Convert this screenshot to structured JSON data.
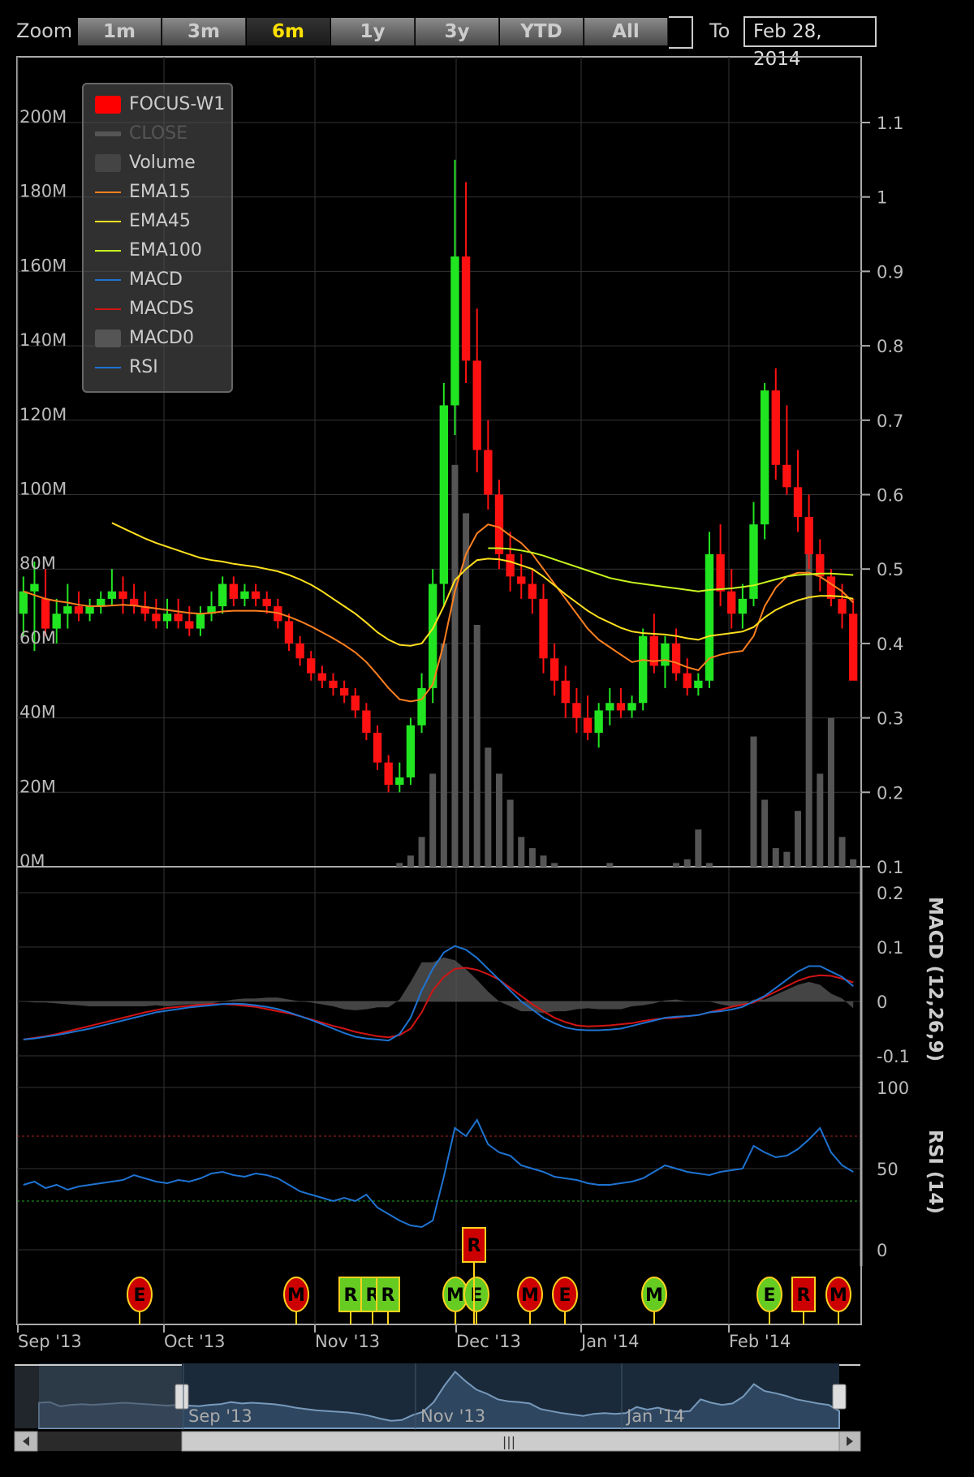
{
  "toolbar": {
    "zoom_label": "Zoom",
    "buttons": [
      "1m",
      "3m",
      "6m",
      "1y",
      "3y",
      "YTD",
      "All"
    ],
    "active": "6m",
    "to_label": "To",
    "to_date": "Feb 28, 2014"
  },
  "chart_data": [
    {
      "type": "candlestick",
      "series": [
        {
          "name": "FOCUS-W1",
          "color": "#ff0000"
        },
        {
          "name": "CLOSE",
          "color": "#444444",
          "hidden": true
        },
        {
          "name": "Volume",
          "color": "#444444"
        },
        {
          "name": "EMA15",
          "color": "#ff7f1e"
        },
        {
          "name": "EMA45",
          "color": "#ffe01e"
        },
        {
          "name": "EMA100",
          "color": "#c8f51e"
        },
        {
          "name": "MACD",
          "color": "#1e73d2"
        },
        {
          "name": "MACDS",
          "color": "#d21414"
        },
        {
          "name": "MACD0",
          "color": "#555555"
        },
        {
          "name": "RSI",
          "color": "#1e73d2"
        }
      ],
      "x_ticks": [
        "Sep '13",
        "Oct '13",
        "Nov '13",
        "Dec '13",
        "Jan '14",
        "Feb '14"
      ],
      "price_ticks": [
        "1.1",
        "1",
        "0.9",
        "0.8",
        "0.7",
        "0.6",
        "0.5",
        "0.4",
        "0.3",
        "0.2",
        "0.1"
      ],
      "volume_ticks": [
        "200M",
        "180M",
        "160M",
        "140M",
        "120M",
        "100M",
        "80M",
        "60M",
        "40M",
        "20M",
        "0M"
      ],
      "ylim_price": [
        0.1,
        1.1
      ],
      "ylim_volume": [
        0,
        200
      ],
      "grid": true,
      "ohlc": [
        [
          0.44,
          0.49,
          0.41,
          0.47
        ],
        [
          0.47,
          0.51,
          0.39,
          0.48
        ],
        [
          0.46,
          0.5,
          0.41,
          0.42
        ],
        [
          0.42,
          0.46,
          0.4,
          0.44
        ],
        [
          0.44,
          0.48,
          0.42,
          0.45
        ],
        [
          0.45,
          0.47,
          0.43,
          0.44
        ],
        [
          0.44,
          0.46,
          0.43,
          0.45
        ],
        [
          0.45,
          0.47,
          0.44,
          0.46
        ],
        [
          0.46,
          0.5,
          0.45,
          0.47
        ],
        [
          0.47,
          0.49,
          0.44,
          0.46
        ],
        [
          0.46,
          0.48,
          0.44,
          0.45
        ],
        [
          0.45,
          0.47,
          0.43,
          0.44
        ],
        [
          0.44,
          0.46,
          0.42,
          0.43
        ],
        [
          0.43,
          0.46,
          0.42,
          0.44
        ],
        [
          0.44,
          0.46,
          0.42,
          0.43
        ],
        [
          0.43,
          0.45,
          0.41,
          0.42
        ],
        [
          0.42,
          0.45,
          0.41,
          0.44
        ],
        [
          0.44,
          0.47,
          0.43,
          0.45
        ],
        [
          0.45,
          0.49,
          0.44,
          0.48
        ],
        [
          0.48,
          0.49,
          0.45,
          0.46
        ],
        [
          0.46,
          0.48,
          0.45,
          0.47
        ],
        [
          0.47,
          0.48,
          0.45,
          0.46
        ],
        [
          0.46,
          0.47,
          0.44,
          0.45
        ],
        [
          0.45,
          0.46,
          0.42,
          0.43
        ],
        [
          0.43,
          0.44,
          0.39,
          0.4
        ],
        [
          0.4,
          0.41,
          0.37,
          0.38
        ],
        [
          0.38,
          0.39,
          0.35,
          0.36
        ],
        [
          0.36,
          0.37,
          0.34,
          0.35
        ],
        [
          0.35,
          0.36,
          0.33,
          0.34
        ],
        [
          0.34,
          0.35,
          0.32,
          0.33
        ],
        [
          0.33,
          0.34,
          0.3,
          0.31
        ],
        [
          0.31,
          0.32,
          0.27,
          0.28
        ],
        [
          0.28,
          0.29,
          0.23,
          0.24
        ],
        [
          0.24,
          0.25,
          0.2,
          0.21
        ],
        [
          0.21,
          0.24,
          0.2,
          0.22
        ],
        [
          0.22,
          0.3,
          0.21,
          0.29
        ],
        [
          0.29,
          0.36,
          0.28,
          0.34
        ],
        [
          0.34,
          0.5,
          0.32,
          0.48
        ],
        [
          0.48,
          0.75,
          0.45,
          0.72
        ],
        [
          0.72,
          1.05,
          0.68,
          0.92
        ],
        [
          0.92,
          1.02,
          0.75,
          0.78
        ],
        [
          0.78,
          0.85,
          0.63,
          0.66
        ],
        [
          0.66,
          0.7,
          0.58,
          0.6
        ],
        [
          0.6,
          0.62,
          0.5,
          0.52
        ],
        [
          0.52,
          0.55,
          0.47,
          0.49
        ],
        [
          0.49,
          0.52,
          0.46,
          0.48
        ],
        [
          0.48,
          0.5,
          0.44,
          0.46
        ],
        [
          0.46,
          0.48,
          0.36,
          0.38
        ],
        [
          0.38,
          0.4,
          0.33,
          0.35
        ],
        [
          0.35,
          0.37,
          0.3,
          0.32
        ],
        [
          0.32,
          0.34,
          0.28,
          0.3
        ],
        [
          0.3,
          0.33,
          0.27,
          0.28
        ],
        [
          0.28,
          0.32,
          0.26,
          0.31
        ],
        [
          0.31,
          0.34,
          0.29,
          0.32
        ],
        [
          0.32,
          0.34,
          0.3,
          0.31
        ],
        [
          0.31,
          0.33,
          0.3,
          0.32
        ],
        [
          0.32,
          0.42,
          0.31,
          0.41
        ],
        [
          0.41,
          0.44,
          0.36,
          0.37
        ],
        [
          0.37,
          0.41,
          0.34,
          0.4
        ],
        [
          0.4,
          0.42,
          0.35,
          0.36
        ],
        [
          0.36,
          0.38,
          0.33,
          0.34
        ],
        [
          0.34,
          0.36,
          0.33,
          0.35
        ],
        [
          0.35,
          0.55,
          0.34,
          0.52
        ],
        [
          0.52,
          0.56,
          0.45,
          0.47
        ],
        [
          0.47,
          0.5,
          0.42,
          0.44
        ],
        [
          0.44,
          0.48,
          0.42,
          0.46
        ],
        [
          0.46,
          0.59,
          0.45,
          0.56
        ],
        [
          0.56,
          0.75,
          0.54,
          0.74
        ],
        [
          0.74,
          0.77,
          0.62,
          0.64
        ],
        [
          0.64,
          0.72,
          0.6,
          0.61
        ],
        [
          0.61,
          0.66,
          0.55,
          0.57
        ],
        [
          0.57,
          0.6,
          0.5,
          0.52
        ],
        [
          0.52,
          0.54,
          0.47,
          0.49
        ],
        [
          0.49,
          0.5,
          0.45,
          0.46
        ],
        [
          0.46,
          0.48,
          0.42,
          0.44
        ],
        [
          0.44,
          0.46,
          0.38,
          0.35
        ]
      ],
      "ema15": [
        0.47,
        0.465,
        0.46,
        0.457,
        0.455,
        0.452,
        0.45,
        0.45,
        0.451,
        0.452,
        0.451,
        0.449,
        0.447,
        0.445,
        0.443,
        0.441,
        0.44,
        0.441,
        0.443,
        0.444,
        0.444,
        0.444,
        0.443,
        0.441,
        0.436,
        0.43,
        0.423,
        0.415,
        0.407,
        0.398,
        0.388,
        0.375,
        0.358,
        0.34,
        0.325,
        0.322,
        0.325,
        0.345,
        0.4,
        0.47,
        0.52,
        0.548,
        0.56,
        0.556,
        0.545,
        0.535,
        0.52,
        0.5,
        0.48,
        0.46,
        0.44,
        0.42,
        0.405,
        0.395,
        0.385,
        0.375,
        0.378,
        0.376,
        0.378,
        0.374,
        0.368,
        0.364,
        0.38,
        0.385,
        0.388,
        0.39,
        0.41,
        0.45,
        0.475,
        0.49,
        0.495,
        0.495,
        0.49,
        0.48,
        0.47,
        0.455
      ],
      "ema45": [
        null,
        null,
        null,
        null,
        null,
        null,
        null,
        null,
        0.562,
        0.555,
        0.548,
        0.541,
        0.535,
        0.53,
        0.525,
        0.52,
        0.515,
        0.512,
        0.51,
        0.507,
        0.505,
        0.503,
        0.5,
        0.497,
        0.492,
        0.486,
        0.479,
        0.47,
        0.46,
        0.45,
        0.44,
        0.428,
        0.415,
        0.405,
        0.398,
        0.397,
        0.4,
        0.42,
        0.45,
        0.485,
        0.5,
        0.512,
        0.514,
        0.513,
        0.51,
        0.505,
        0.5,
        0.49,
        0.478,
        0.466,
        0.455,
        0.444,
        0.435,
        0.428,
        0.421,
        0.416,
        0.414,
        0.413,
        0.412,
        0.41,
        0.407,
        0.405,
        0.41,
        0.412,
        0.414,
        0.416,
        0.422,
        0.435,
        0.445,
        0.452,
        0.458,
        0.462,
        0.464,
        0.464,
        0.463,
        0.46
      ],
      "ema100": [
        null,
        null,
        null,
        null,
        null,
        null,
        null,
        null,
        null,
        null,
        null,
        null,
        null,
        null,
        null,
        null,
        null,
        null,
        null,
        null,
        null,
        null,
        null,
        null,
        null,
        null,
        null,
        null,
        null,
        null,
        null,
        null,
        null,
        null,
        null,
        null,
        null,
        null,
        null,
        null,
        null,
        null,
        0.528,
        0.528,
        0.527,
        0.525,
        0.522,
        0.518,
        0.513,
        0.508,
        0.503,
        0.498,
        0.493,
        0.488,
        0.485,
        0.482,
        0.48,
        0.478,
        0.476,
        0.474,
        0.472,
        0.47,
        0.472,
        0.473,
        0.474,
        0.476,
        0.478,
        0.482,
        0.486,
        0.49,
        0.492,
        0.493,
        0.494,
        0.494,
        0.493,
        0.492
      ],
      "volume": [
        0,
        0,
        0,
        0,
        0,
        0,
        0,
        0,
        0,
        0,
        0,
        0,
        0,
        0,
        0,
        0,
        0,
        0,
        0,
        0,
        0,
        0,
        0,
        0,
        0,
        0,
        0,
        0,
        0,
        0,
        0,
        0,
        0,
        0,
        1,
        3,
        8,
        25,
        60,
        108,
        95,
        65,
        32,
        25,
        18,
        8,
        5,
        3,
        1,
        0,
        0,
        0,
        0,
        1,
        0,
        0,
        0,
        0,
        0,
        1,
        2,
        10,
        1,
        0,
        0,
        0,
        35,
        18,
        5,
        4,
        15,
        85,
        25,
        40,
        8,
        2
      ],
      "macd": [
        -0.07,
        -0.068,
        -0.065,
        -0.062,
        -0.058,
        -0.054,
        -0.05,
        -0.045,
        -0.04,
        -0.035,
        -0.03,
        -0.025,
        -0.02,
        -0.017,
        -0.014,
        -0.011,
        -0.009,
        -0.007,
        -0.005,
        -0.004,
        -0.005,
        -0.007,
        -0.01,
        -0.014,
        -0.02,
        -0.027,
        -0.034,
        -0.042,
        -0.05,
        -0.058,
        -0.065,
        -0.068,
        -0.07,
        -0.072,
        -0.06,
        -0.03,
        0.02,
        0.06,
        0.09,
        0.102,
        0.095,
        0.08,
        0.06,
        0.04,
        0.02,
        0.0,
        -0.015,
        -0.03,
        -0.04,
        -0.048,
        -0.052,
        -0.053,
        -0.053,
        -0.052,
        -0.05,
        -0.045,
        -0.04,
        -0.035,
        -0.03,
        -0.028,
        -0.027,
        -0.025,
        -0.02,
        -0.018,
        -0.015,
        -0.01,
        0.0,
        0.01,
        0.025,
        0.04,
        0.055,
        0.065,
        0.065,
        0.055,
        0.045,
        0.028
      ],
      "macds": [
        -0.07,
        -0.067,
        -0.064,
        -0.06,
        -0.055,
        -0.05,
        -0.045,
        -0.04,
        -0.035,
        -0.03,
        -0.025,
        -0.02,
        -0.016,
        -0.012,
        -0.01,
        -0.008,
        -0.006,
        -0.005,
        -0.005,
        -0.006,
        -0.008,
        -0.01,
        -0.014,
        -0.018,
        -0.022,
        -0.027,
        -0.033,
        -0.039,
        -0.045,
        -0.05,
        -0.056,
        -0.06,
        -0.064,
        -0.066,
        -0.062,
        -0.05,
        -0.02,
        0.02,
        0.045,
        0.06,
        0.062,
        0.058,
        0.05,
        0.04,
        0.025,
        0.01,
        -0.005,
        -0.018,
        -0.03,
        -0.038,
        -0.044,
        -0.046,
        -0.045,
        -0.044,
        -0.042,
        -0.04,
        -0.036,
        -0.033,
        -0.031,
        -0.03,
        -0.027,
        -0.025,
        -0.02,
        -0.015,
        -0.01,
        -0.006,
        -0.002,
        0.008,
        0.018,
        0.028,
        0.038,
        0.045,
        0.048,
        0.047,
        0.042,
        0.035
      ],
      "rsi": [
        40,
        42,
        38,
        40,
        37,
        39,
        40,
        41,
        42,
        43,
        46,
        44,
        42,
        41,
        43,
        42,
        44,
        47,
        48,
        46,
        45,
        47,
        46,
        44,
        40,
        36,
        34,
        32,
        30,
        32,
        30,
        34,
        26,
        22,
        18,
        15,
        14,
        18,
        45,
        75,
        70,
        80,
        65,
        60,
        58,
        52,
        50,
        48,
        45,
        44,
        43,
        41,
        40,
        40,
        41,
        42,
        44,
        48,
        52,
        50,
        48,
        47,
        46,
        48,
        49,
        50,
        64,
        60,
        57,
        58,
        62,
        68,
        75,
        60,
        52,
        48
      ]
    }
  ],
  "macd_ticks": [
    "0.2",
    "0.1",
    "0",
    "-0.1"
  ],
  "rsi_ticks": [
    "100",
    "50",
    "0"
  ],
  "macd_title": "MACD (12,26,9)",
  "rsi_title": "RSI (14)",
  "flags": [
    {
      "label": "E",
      "color": "#cc0000",
      "shape": "circle"
    },
    {
      "label": "M",
      "color": "#cc0000",
      "shape": "circle"
    },
    {
      "label": "R",
      "color": "#66cc22",
      "shape": "square"
    },
    {
      "label": "R",
      "color": "#66cc22",
      "shape": "square"
    },
    {
      "label": "R",
      "color": "#66cc22",
      "shape": "square"
    },
    {
      "label": "M",
      "color": "#66cc22",
      "shape": "circle"
    },
    {
      "label": "E",
      "color": "#66cc22",
      "shape": "circle"
    },
    {
      "label": "R",
      "color": "#cc0000",
      "shape": "square"
    },
    {
      "label": "M",
      "color": "#cc0000",
      "shape": "circle"
    },
    {
      "label": "E",
      "color": "#cc0000",
      "shape": "circle"
    },
    {
      "label": "M",
      "color": "#66cc22",
      "shape": "circle"
    },
    {
      "label": "E",
      "color": "#66cc22",
      "shape": "circle"
    },
    {
      "label": "R",
      "color": "#cc0000",
      "shape": "square"
    },
    {
      "label": "M",
      "color": "#cc0000",
      "shape": "circle"
    }
  ],
  "navigator": {
    "labels": [
      "Sep '13",
      "Nov '13",
      "Jan '14"
    ]
  }
}
